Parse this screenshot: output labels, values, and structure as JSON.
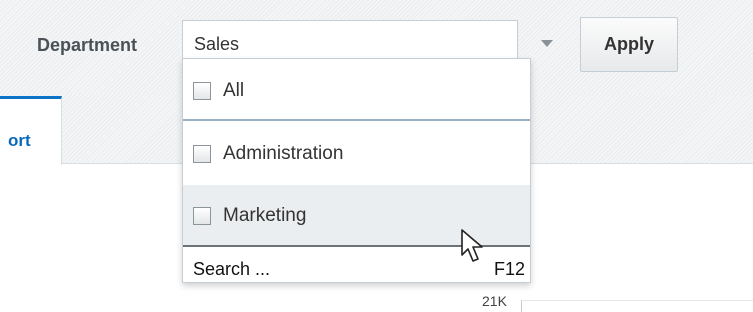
{
  "filter": {
    "department_label": "Department",
    "selected_value": "Sales",
    "apply_label": "Apply"
  },
  "tabs": [
    {
      "label": "ort"
    }
  ],
  "dropdown": {
    "options": [
      {
        "label": "All",
        "checked": false
      },
      {
        "label": "Administration",
        "checked": false
      },
      {
        "label": "Marketing",
        "checked": false,
        "hovered": true
      }
    ],
    "search_label": "Search ...",
    "shortcut": "F12"
  },
  "chart": {
    "tick_label": "21K"
  },
  "icons": {
    "dropdown_arrow": "chevron-down-icon",
    "cursor": "mouse-pointer-icon"
  },
  "colors": {
    "accent": "#0b73c7",
    "hover_row": "#ebeef0"
  }
}
